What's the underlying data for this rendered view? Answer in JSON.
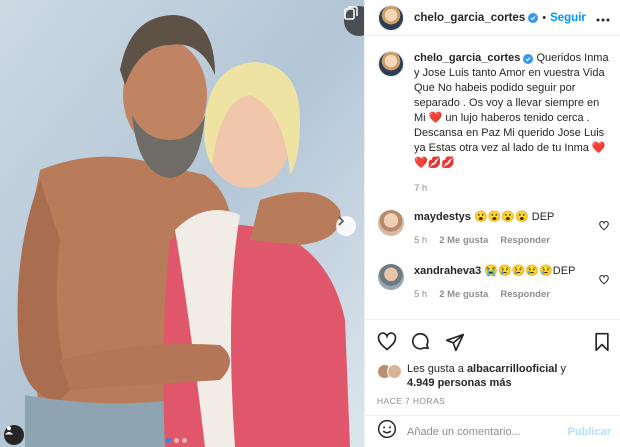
{
  "post": {
    "username": "chelo_garcia_cortes",
    "follow_label": "Seguir",
    "dot": "•"
  },
  "caption": {
    "text": " Queridos Inma y Jose Luis tanto Amor en vuestra Vida Que No habeis podido seguir por separado . Os voy a llevar siempre en Mi ❤️ un lujo haberos tenido cerca . Descansa en Paz Mi querido Jose Luis ya Estas otra vez al lado de tu Inma ❤️ ❤️💋💋",
    "time": "7 h"
  },
  "comments": [
    {
      "username": "maydestys",
      "text": "😮😮😮😮 DEP",
      "time": "5 h",
      "likes": "2 Me gusta",
      "reply": "Responder",
      "avatar_color": "#d9b9a6"
    },
    {
      "username": "xandraheva3",
      "text": "😭😢😢😢😢DEP",
      "time": "5 h",
      "likes": "2 Me gusta",
      "reply": "Responder",
      "avatar_color": "#9aa7b2"
    }
  ],
  "likes": {
    "prefix": "Les gusta a ",
    "user": "albacarrillooficial",
    "joiner": " y",
    "count": "4.949 personas más"
  },
  "posted_ago": "HACE 7 HORAS",
  "add_comment": {
    "placeholder": "Añade un comentario...",
    "publish_label": "Publicar"
  },
  "colors": {
    "accent": "#0095f6",
    "verified": "#3897f0",
    "heart": "#ed4956"
  },
  "icons": [
    "carousel-icon",
    "next-arrow-icon",
    "user-tag-icon",
    "verified-icon",
    "more-icon",
    "heart-icon",
    "comment-icon",
    "share-icon",
    "save-icon",
    "emoji-icon"
  ],
  "carousel": {
    "slides": 3,
    "active": 1
  }
}
